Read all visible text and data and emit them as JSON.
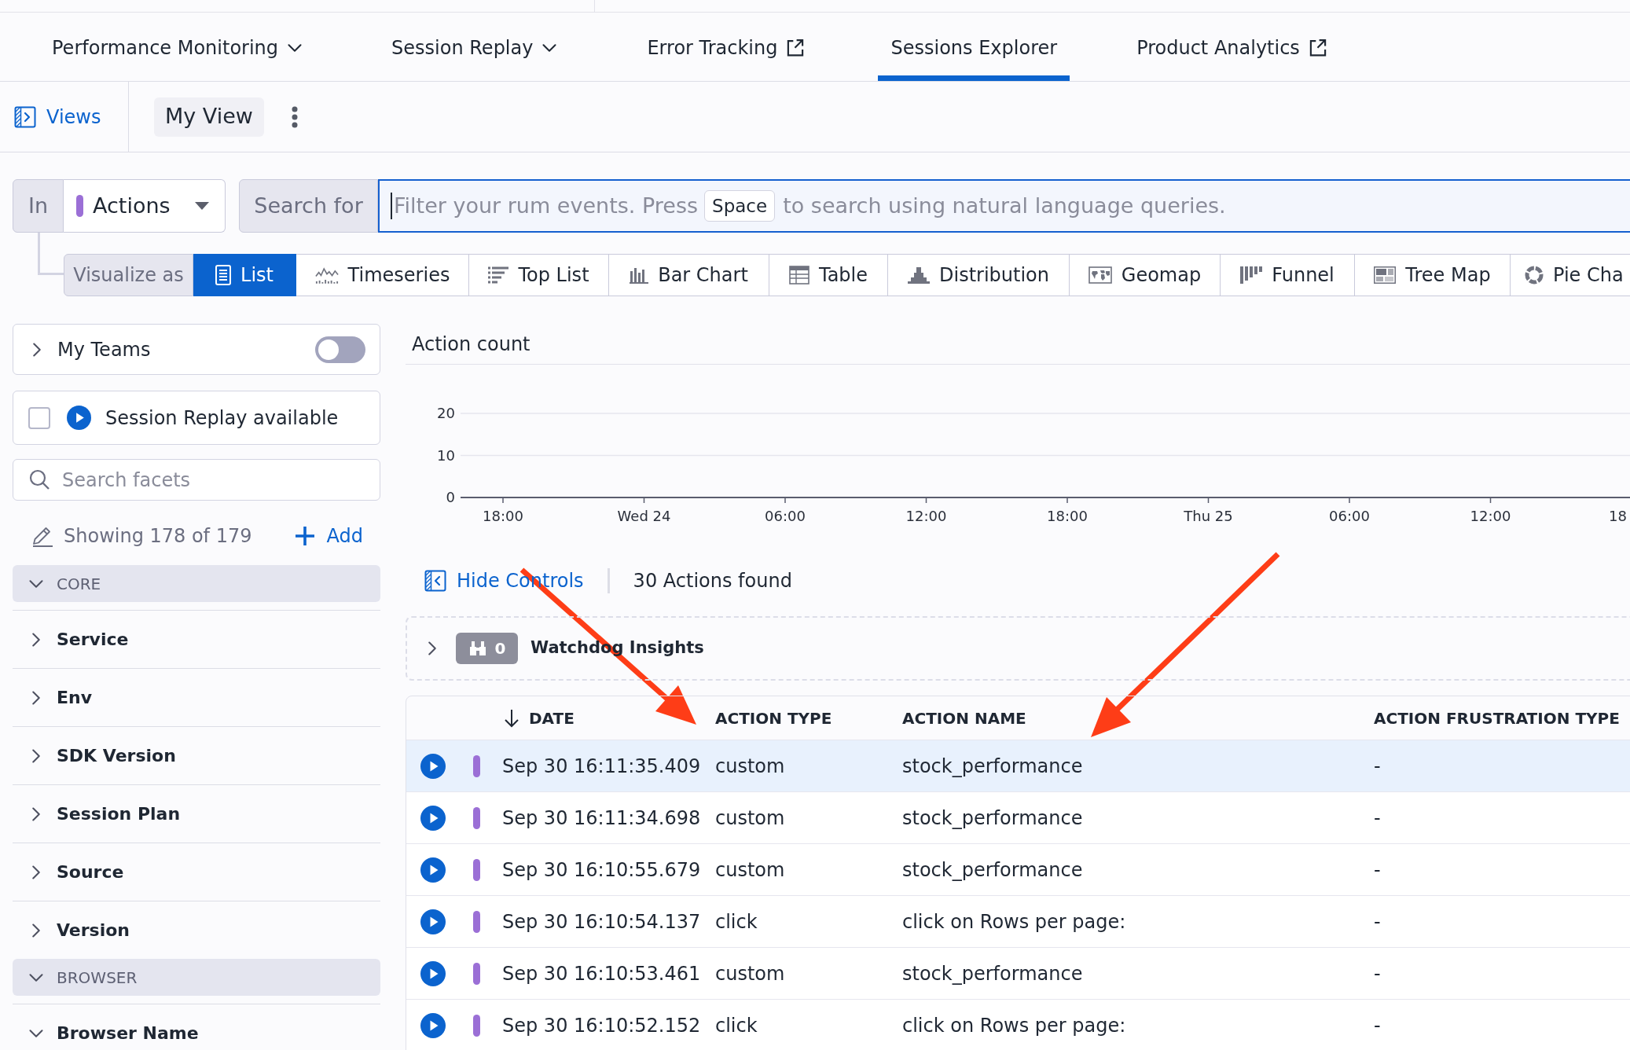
{
  "nav_tabs": [
    {
      "label": "Performance Monitoring",
      "kind": "menu",
      "selected": false
    },
    {
      "label": "Session Replay",
      "kind": "menu",
      "selected": false
    },
    {
      "label": "Error Tracking",
      "kind": "external",
      "selected": false
    },
    {
      "label": "Sessions Explorer",
      "kind": "link",
      "selected": true
    },
    {
      "label": "Product Analytics",
      "kind": "external",
      "selected": false
    }
  ],
  "views_bar": {
    "views_label": "Views",
    "current_view": "My View"
  },
  "query": {
    "scope_label": "In",
    "data_source": "Actions",
    "search_label": "Search for",
    "placeholder_start": "Filter your rum events. Press",
    "placeholder_key": "Space",
    "placeholder_end": "to search using natural language queries."
  },
  "visualize": {
    "label": "Visualize as",
    "options": [
      {
        "label": "List",
        "selected": true
      },
      {
        "label": "Timeseries",
        "selected": false
      },
      {
        "label": "Top List",
        "selected": false
      },
      {
        "label": "Bar Chart",
        "selected": false
      },
      {
        "label": "Table",
        "selected": false
      },
      {
        "label": "Distribution",
        "selected": false
      },
      {
        "label": "Geomap",
        "selected": false
      },
      {
        "label": "Funnel",
        "selected": false
      },
      {
        "label": "Tree Map",
        "selected": false
      },
      {
        "label": "Pie Cha",
        "selected": false
      }
    ]
  },
  "sidebar": {
    "my_teams": {
      "label": "My Teams",
      "on": false
    },
    "session_replay": {
      "label": "Session Replay available",
      "checked": false
    },
    "facet_search": {
      "placeholder": "Search facets"
    },
    "facet_count": "Showing 178 of 179",
    "add_label": "Add",
    "groups": [
      {
        "label": "CORE",
        "expanded": true,
        "items": [
          {
            "label": "Service",
            "expanded": false
          },
          {
            "label": "Env",
            "expanded": false
          },
          {
            "label": "SDK Version",
            "expanded": false
          },
          {
            "label": "Session Plan",
            "expanded": false
          },
          {
            "label": "Source",
            "expanded": false
          },
          {
            "label": "Version",
            "expanded": false
          }
        ]
      },
      {
        "label": "BROWSER",
        "expanded": true,
        "items": [
          {
            "label": "Browser Name",
            "expanded": true
          }
        ]
      }
    ]
  },
  "chart": {
    "chart_data": {
      "type": "bar",
      "title": "Action count",
      "categories": [
        "18:00",
        "Wed 24",
        "06:00",
        "12:00",
        "18:00",
        "Thu 25",
        "06:00",
        "12:00",
        "18"
      ],
      "ylim": [
        0,
        20
      ],
      "yticks": [
        0,
        10,
        20
      ]
    }
  },
  "results": {
    "hide_controls": "Hide Controls",
    "count": "30 Actions found"
  },
  "watchdog": {
    "expanded": false,
    "count": "0",
    "label": "Watchdog Insights"
  },
  "table": {
    "columns": [
      {
        "label": "DATE",
        "sorted": true
      },
      {
        "label": "ACTION TYPE",
        "sorted": false
      },
      {
        "label": "ACTION NAME",
        "sorted": false
      },
      {
        "label": "ACTION FRUSTRATION TYPE",
        "sorted": false
      }
    ],
    "rows": [
      {
        "selected": true,
        "date": "Sep 30 16:11:35.409",
        "action_type": "custom",
        "action_name": "stock_performance",
        "frustration": "-"
      },
      {
        "selected": false,
        "date": "Sep 30 16:11:34.698",
        "action_type": "custom",
        "action_name": "stock_performance",
        "frustration": "-"
      },
      {
        "selected": false,
        "date": "Sep 30 16:10:55.679",
        "action_type": "custom",
        "action_name": "stock_performance",
        "frustration": "-"
      },
      {
        "selected": false,
        "date": "Sep 30 16:10:54.137",
        "action_type": "click",
        "action_name": "click on Rows per page:",
        "frustration": "-"
      },
      {
        "selected": false,
        "date": "Sep 30 16:10:53.461",
        "action_type": "custom",
        "action_name": "stock_performance",
        "frustration": "-"
      },
      {
        "selected": false,
        "date": "Sep 30 16:10:52.152",
        "action_type": "click",
        "action_name": "click on Rows per page:",
        "frustration": "-"
      }
    ]
  }
}
